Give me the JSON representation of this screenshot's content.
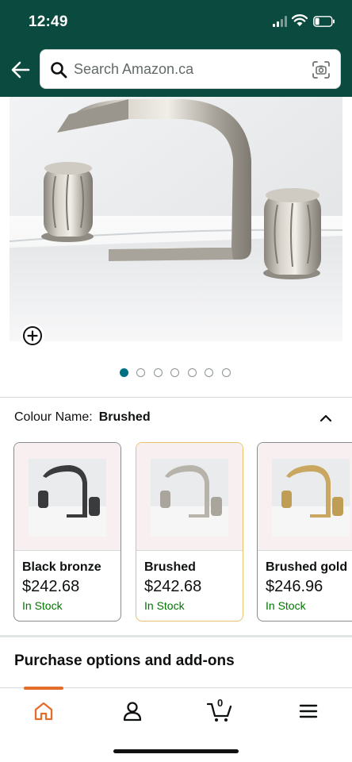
{
  "status_bar": {
    "time": "12:49"
  },
  "header": {
    "search_placeholder": "Search Amazon.ca"
  },
  "gallery": {
    "image_count": 7,
    "active_index": 0
  },
  "colour": {
    "label": "Colour Name:",
    "selected": "Brushed"
  },
  "swatches": [
    {
      "name": "Black bronze",
      "price": "$242.68",
      "stock": "In Stock",
      "color": "#3a3b3d"
    },
    {
      "name": "Brushed",
      "price": "$242.68",
      "stock": "In Stock",
      "color": "#b7b3ab"
    },
    {
      "name": "Brushed gold",
      "price": "$246.96",
      "stock": "In Stock",
      "color": "#c9a760"
    }
  ],
  "section": {
    "purchase_title": "Purchase options and add-ons"
  },
  "bottom_nav": {
    "cart_count": "0",
    "active": "home"
  },
  "colors": {
    "header_bg": "#0b4b3f",
    "accent": "#007185",
    "in_stock": "#007600",
    "nav_active": "#e46d2c"
  }
}
